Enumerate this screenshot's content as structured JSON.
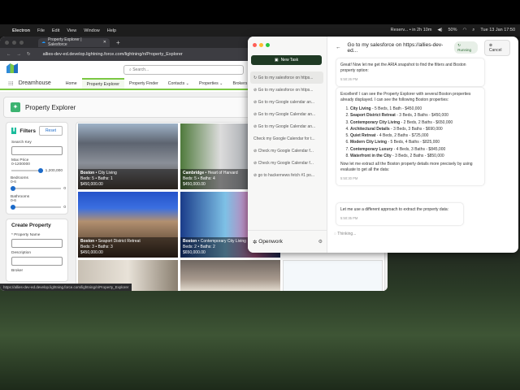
{
  "menubar": {
    "app": "Electron",
    "items": [
      "File",
      "Edit",
      "View",
      "Window",
      "Help"
    ],
    "reminder": "Reserv... • in 2h 10m",
    "battery": "50%",
    "datetime": "Tue 13 Jan 17:50"
  },
  "browser": {
    "tab_title": "Property Explorer | Salesforce",
    "url": "allies-dev-ed.develop.lightning.force.com/lightning/n/Property_Explorer",
    "status_url": "https://allies-dev-ed.develop.lightning.force.com/lightning/n/Property_Explorer"
  },
  "sf": {
    "search_placeholder": "Search...",
    "app_name": "Dreamhouse",
    "nav": [
      "Home",
      "Property Explorer",
      "Property Finder",
      "Contacts",
      "Properties",
      "Brokers"
    ],
    "page_title": "Property Explorer",
    "filters": {
      "title": "Filters",
      "reset": "Reset",
      "search_key": "Search Key",
      "max_price": "Max Price",
      "max_price_range": "0-1200000",
      "max_price_value": "1,200,000",
      "bedrooms": "Bedrooms",
      "bedrooms_range": "0-6",
      "bedrooms_value": "0",
      "bathrooms": "Bathrooms",
      "bathrooms_range": "0-6",
      "bathrooms_value": "0"
    },
    "create": {
      "title": "Create Property",
      "name": "* Property Name",
      "description": "Description",
      "broker": "Broker"
    },
    "properties": [
      {
        "city": "Boston",
        "name": "City Living",
        "details": "Beds: 5 • Baths: 1",
        "price": "$450,000.00"
      },
      {
        "city": "Cambridge",
        "name": "Heart of Harvard",
        "details": "Beds: 5 • Baths: 4",
        "price": "$450,000.00"
      },
      {
        "city": "Boston",
        "name": "Seaport District Retreat",
        "details": "Beds: 3 • Baths: 3",
        "price": "$450,000.00"
      },
      {
        "city": "Boston",
        "name": "Contemporary City Living",
        "details": "Beds: 2 • Baths: 2",
        "price": "$650,000.00"
      }
    ]
  },
  "openwork": {
    "new_task": "New Task",
    "history": [
      "Go to my salesforce on https...",
      "Go to my salesforce on https...",
      "Go to my Google calendar an...",
      "Go to my Google Calendar an...",
      "Go to my Google Calendar an...",
      "Check my Google Calendar for t...",
      "Check my Google Calendar f...",
      "Check my Google Calendar f...",
      "go to hackernews fetch #1 po..."
    ],
    "brand": "Openwork",
    "task_title": "Go to my salesforce on https://allies-dev-ed...",
    "running": "Running",
    "cancel": "Cancel",
    "msg1": {
      "text": "Great! Now let me get the ARIA snapshot to find the filters and Boston property option:",
      "time": "5:50:26 PM"
    },
    "msg2": {
      "intro": "Excellent! I can see the Property Explorer with several Boston properties already displayed. I can see the following Boston properties:",
      "items": [
        {
          "name": "City Living",
          "rest": " - 5 Beds, 1 Bath - $450,000"
        },
        {
          "name": "Seaport District Retreat",
          "rest": " - 3 Beds, 3 Baths - $450,000"
        },
        {
          "name": "Contemporary City Living",
          "rest": " - 2 Beds, 2 Baths - $650,000"
        },
        {
          "name": "Architectural Details",
          "rest": " - 3 Beds, 3 Baths - $690,000"
        },
        {
          "name": "Quiet Retreat",
          "rest": " - 4 Beds, 2 Baths - $725,000"
        },
        {
          "name": "Modern City Living",
          "rest": " - 5 Beds, 4 Baths - $825,000"
        },
        {
          "name": "Contemporary Luxury",
          "rest": " - 4 Beds, 3 Baths - $845,000"
        },
        {
          "name": "Waterfront in the City",
          "rest": " - 3 Beds, 2 Baths - $850,000"
        }
      ],
      "outro": "Now let me extract all the Boston property details more precisely by using evaluate to get all the data:",
      "time": "5:50:30 PM"
    },
    "msg3": {
      "text": "Let me use a different approach to extract the property data:",
      "time": "5:50:35 PM"
    },
    "thinking": "Thinking..."
  }
}
